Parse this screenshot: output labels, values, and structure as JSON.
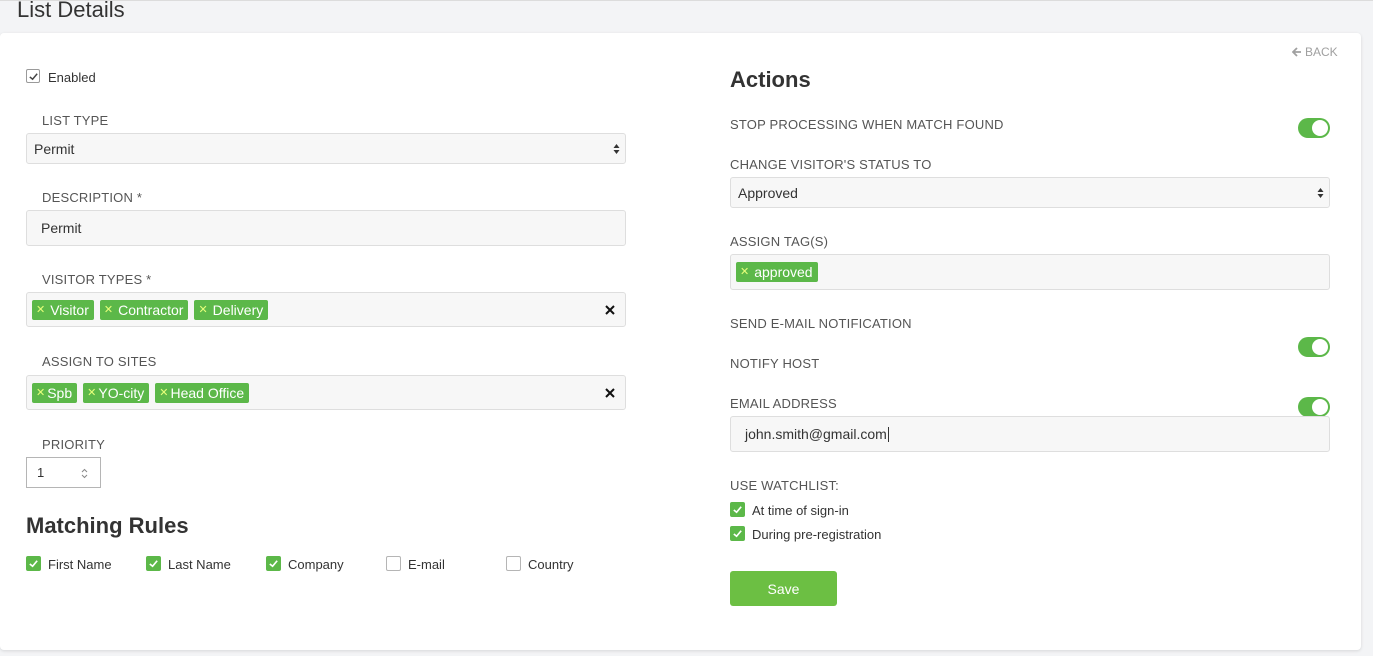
{
  "page_title": "List Details",
  "back_label": "BACK",
  "left": {
    "enabled_label": "Enabled",
    "list_type": {
      "label": "LIST TYPE",
      "value": "Permit"
    },
    "description": {
      "label": "DESCRIPTION *",
      "value": "Permit"
    },
    "visitor_types": {
      "label": "VISITOR TYPES *",
      "tags": [
        "Visitor",
        "Contractor",
        "Delivery"
      ]
    },
    "assign_sites": {
      "label": "ASSIGN TO SITES",
      "tags": [
        "Spb",
        "YO-city",
        "Head Office"
      ]
    },
    "priority": {
      "label": "PRIORITY",
      "value": "1"
    },
    "matching_rules": {
      "title": "Matching Rules",
      "items": [
        {
          "label": "First Name",
          "checked": true
        },
        {
          "label": "Last Name",
          "checked": true
        },
        {
          "label": "Company",
          "checked": true
        },
        {
          "label": "E-mail",
          "checked": false
        },
        {
          "label": "Country",
          "checked": false
        }
      ]
    }
  },
  "right": {
    "title": "Actions",
    "stop_processing_label": "STOP PROCESSING WHEN MATCH FOUND",
    "change_status": {
      "label": "CHANGE VISITOR'S STATUS TO",
      "value": "Approved"
    },
    "assign_tags": {
      "label": "ASSIGN TAG(S)",
      "tags": [
        "approved"
      ]
    },
    "send_email_label": "SEND E-MAIL NOTIFICATION",
    "notify_host_label": "NOTIFY HOST",
    "email": {
      "label": "EMAIL ADDRESS",
      "value": "john.smith@gmail.com"
    },
    "watchlist": {
      "label": "USE WATCHLIST:",
      "items": [
        {
          "label": "At time of sign-in",
          "checked": true
        },
        {
          "label": "During pre-registration",
          "checked": true
        }
      ]
    },
    "save_label": "Save"
  },
  "colors": {
    "accent_green": "#5cb849",
    "tag_x": "#e7ff7a",
    "save_button": "#6cbf43"
  }
}
